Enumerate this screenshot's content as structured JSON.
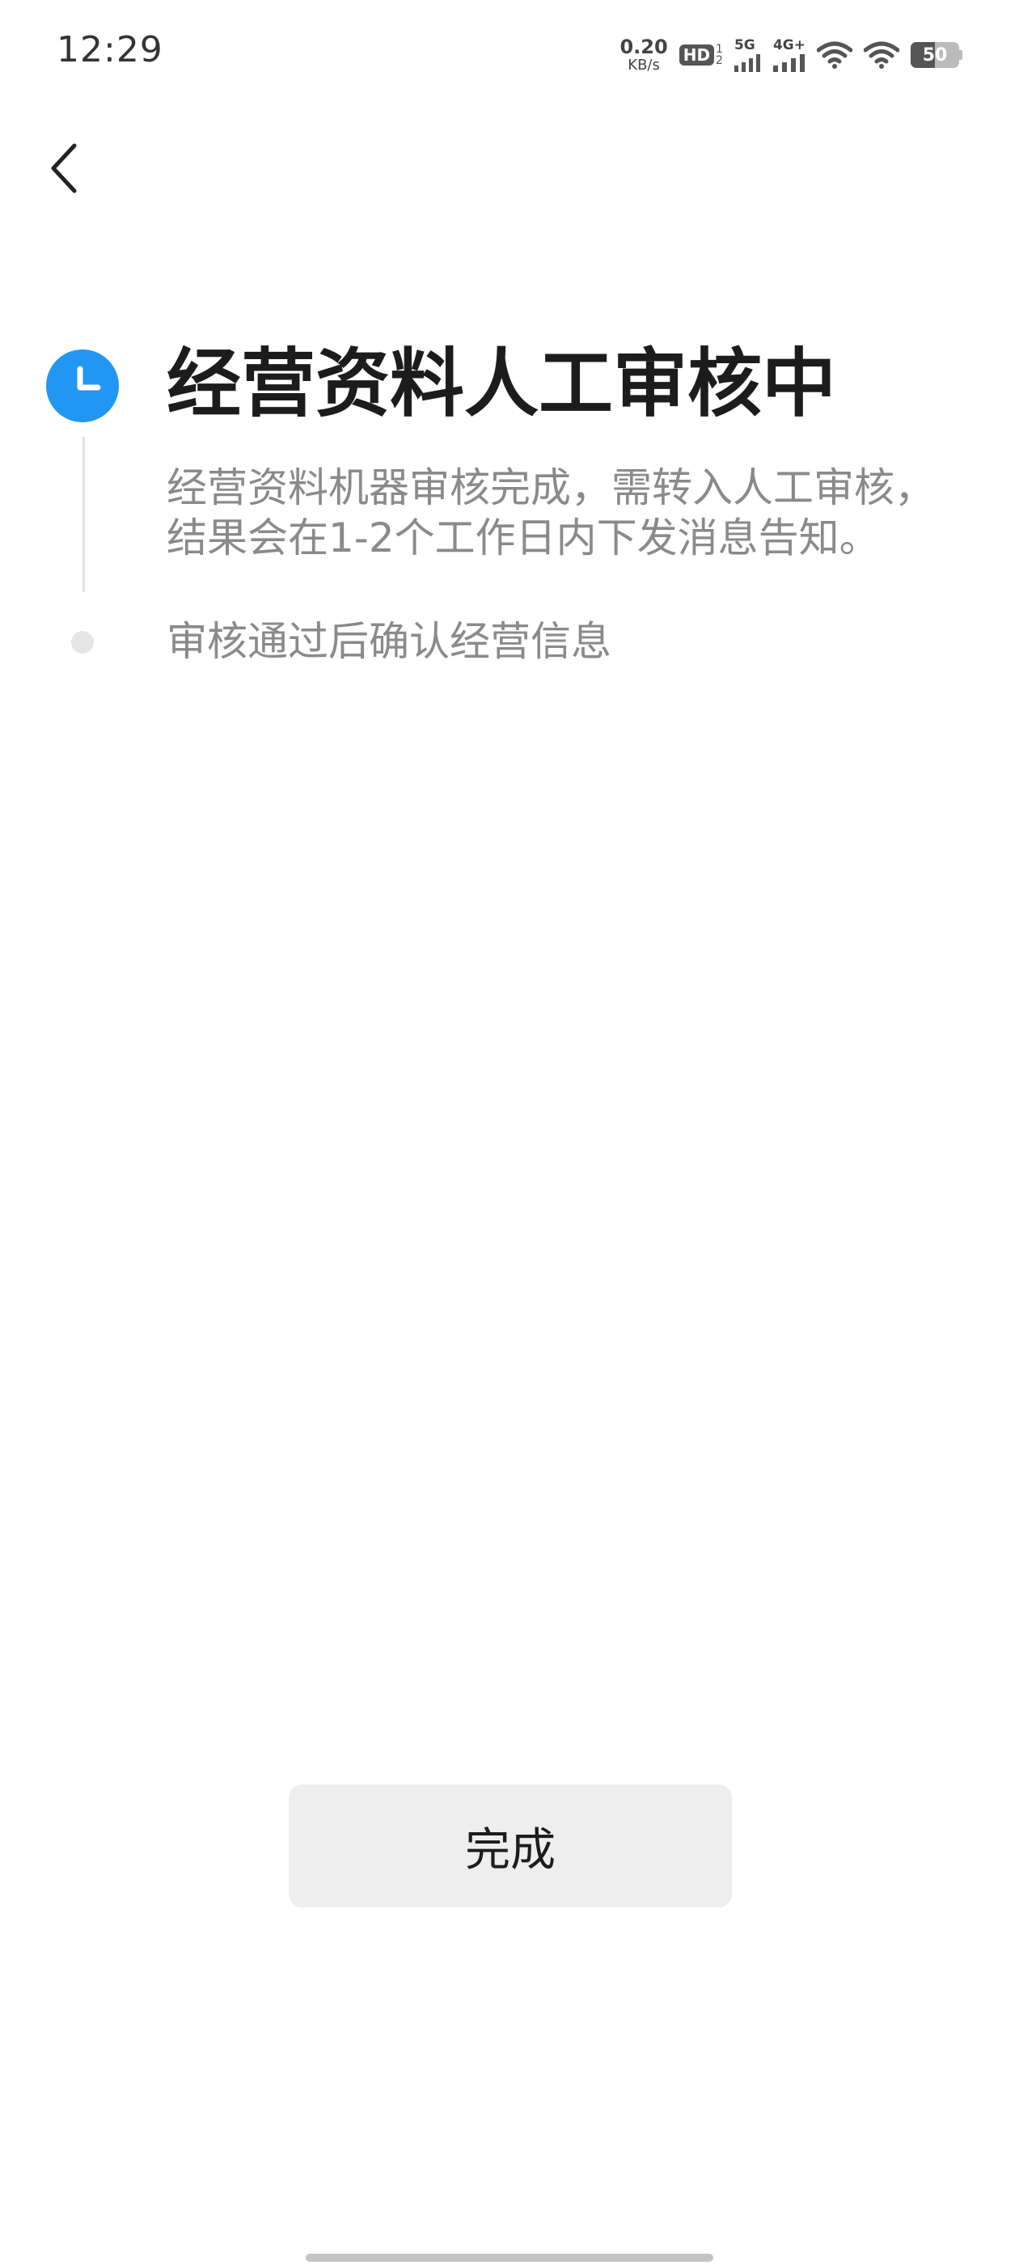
{
  "status_bar": {
    "time": "12:29",
    "net_speed_value": "0.20",
    "net_speed_unit": "KB/s",
    "hd_label": "HD",
    "hd_sub_top": "1",
    "hd_sub_bottom": "2",
    "signal1_label": "5G",
    "signal2_label": "4G+",
    "battery_level": "50"
  },
  "progress": {
    "current_step_title": "经营资料人工审核中",
    "current_step_desc_line1": "经营资料机器审核完成，需转入人工审核，",
    "current_step_desc_line2": "结果会在1-2个工作日内下发消息告知。",
    "next_step_label": "审核通过后确认经营信息"
  },
  "actions": {
    "done_label": "完成"
  },
  "colors": {
    "accent": "#2196f3",
    "muted_text": "#8a8a8a",
    "button_bg": "#eeeeee"
  }
}
